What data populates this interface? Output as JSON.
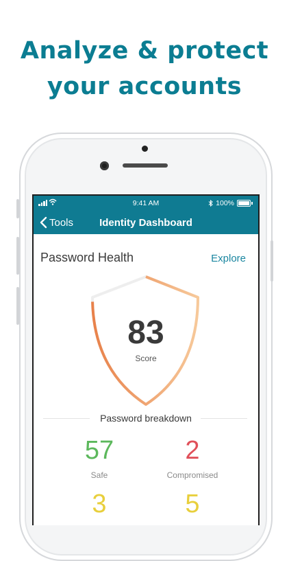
{
  "headline": {
    "line1": "Analyze & protect",
    "line2": "your accounts"
  },
  "status_bar": {
    "time": "9:41 AM",
    "battery": "100%",
    "icons": [
      "signal-icon",
      "wifi-icon",
      "bluetooth-icon",
      "battery-icon"
    ]
  },
  "nav": {
    "back_label": "Tools",
    "title": "Identity Dashboard",
    "bar_color": "#0f7b92"
  },
  "card": {
    "title": "Password Health",
    "explore_label": "Explore",
    "score": "83",
    "score_label": "Score",
    "score_fraction": 0.83,
    "breakdown_title": "Password breakdown"
  },
  "stats": [
    {
      "value": "57",
      "label": "Safe",
      "color": "#5cb85c"
    },
    {
      "value": "2",
      "label": "Compromised",
      "color": "#e0505a"
    },
    {
      "value": "3",
      "label": "",
      "color": "#e8cf3c"
    },
    {
      "value": "5",
      "label": "",
      "color": "#e8cf3c"
    }
  ],
  "colors": {
    "accent": "#0b7d92",
    "gauge_start": "#e8814a",
    "gauge_end": "#f7c99a"
  }
}
